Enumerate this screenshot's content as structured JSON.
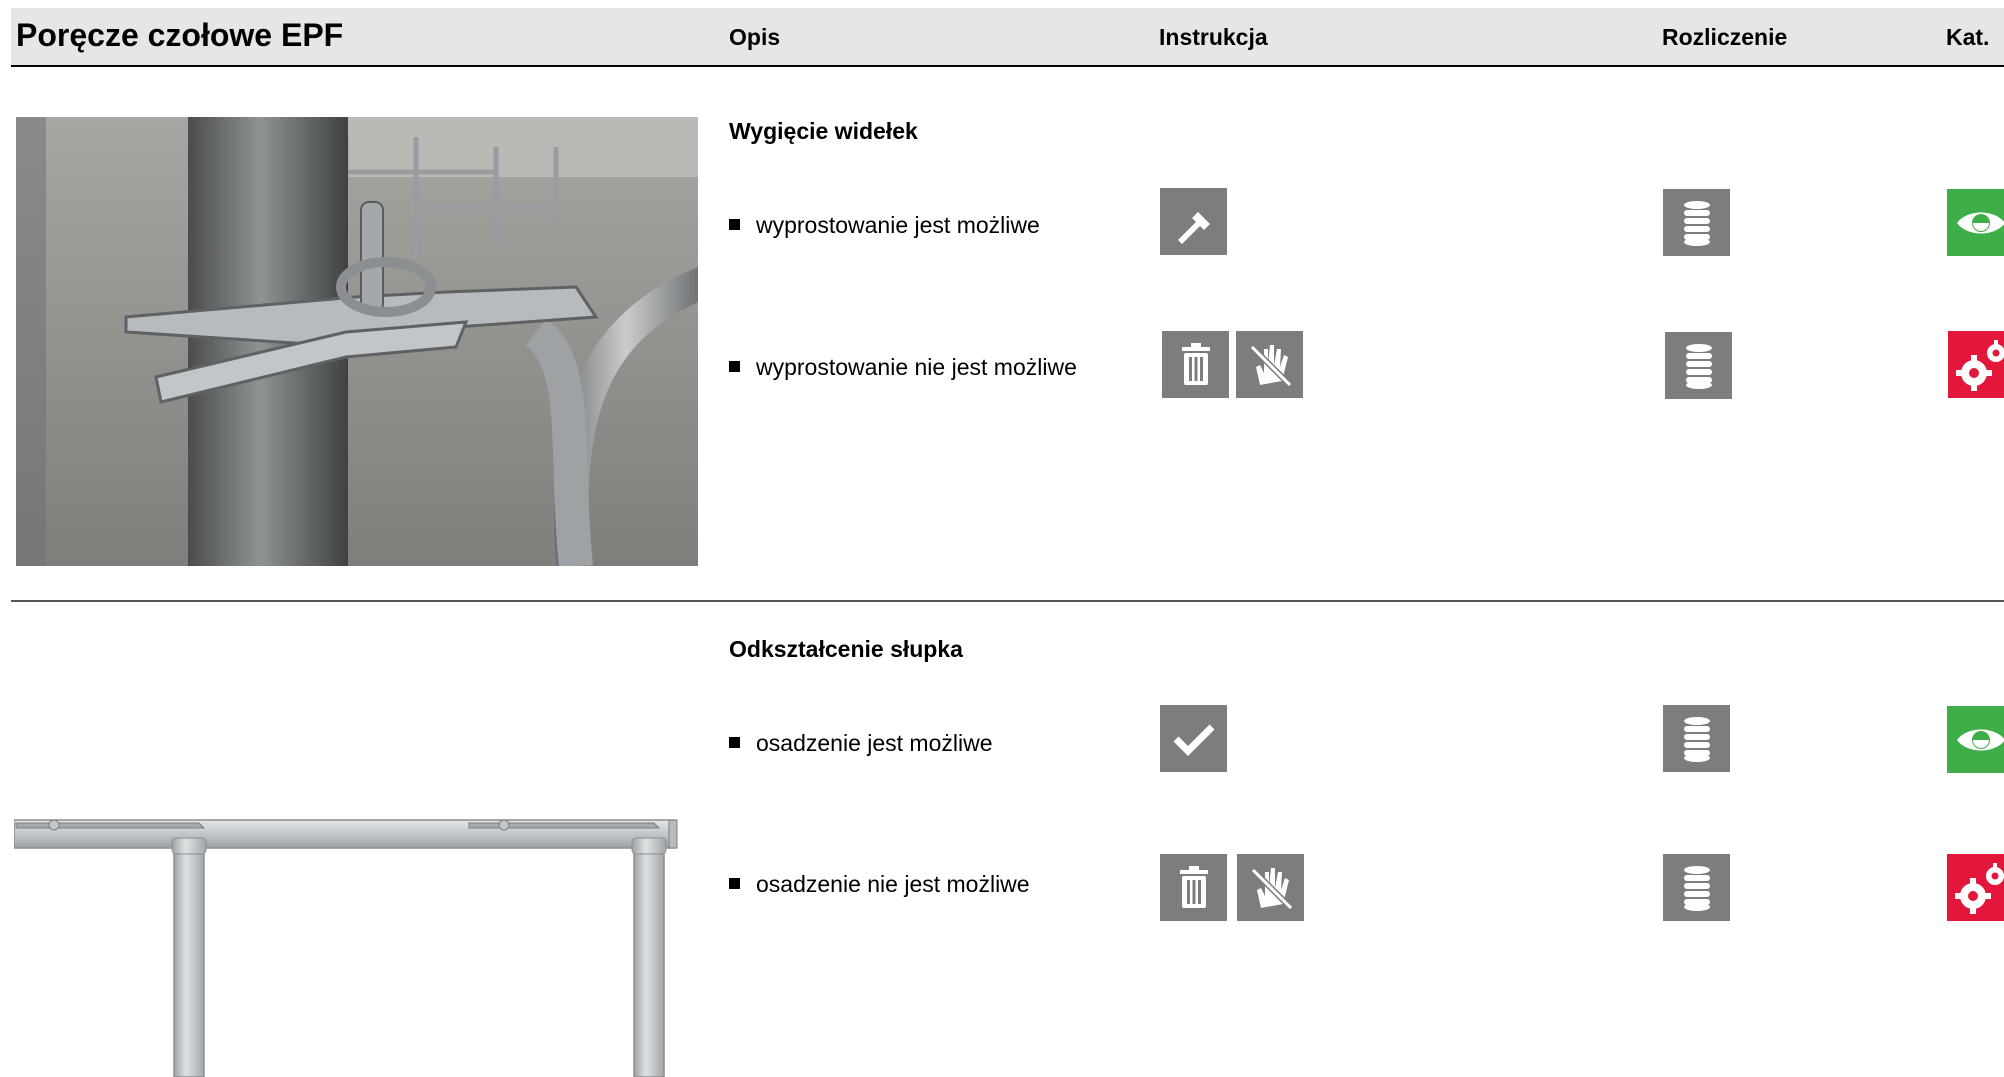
{
  "header": {
    "title": "Poręcze czołowe EPF",
    "col_opis": "Opis",
    "col_instrukcja": "Instrukcja",
    "col_rozliczenie": "Rozliczenie",
    "col_kat": "Kat."
  },
  "sections": [
    {
      "title": "Wygięcie widełek",
      "rows": [
        {
          "text": "wyprostowanie jest możliwe",
          "instructions": [
            "hammer-icon"
          ],
          "billing": "coins-icon",
          "category": "eye-icon"
        },
        {
          "text": "wyprostowanie nie jest możliwe",
          "instructions": [
            "trash-icon",
            "no-hand-icon"
          ],
          "billing": "coins-icon",
          "category": "gears-icon"
        }
      ]
    },
    {
      "title": "Odkształcenie słupka",
      "rows": [
        {
          "text": "osadzenie jest możliwe",
          "instructions": [
            "checkmark-icon"
          ],
          "billing": "coins-icon",
          "category": "eye-icon"
        },
        {
          "text": "osadzenie nie jest możliwe",
          "instructions": [
            "trash-icon",
            "no-hand-icon"
          ],
          "billing": "coins-icon",
          "category": "gears-icon"
        }
      ]
    }
  ],
  "colors": {
    "icon_gray": "#7d7d7d",
    "category_green": "#3fae49",
    "category_red": "#e3173c",
    "header_bg": "#e6e6e6"
  }
}
